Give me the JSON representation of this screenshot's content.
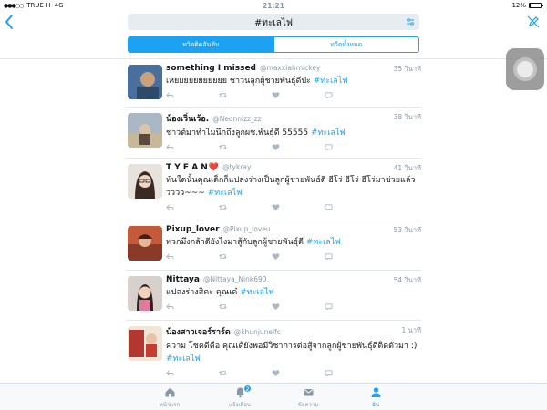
{
  "status_bar": {
    "carrier": "TRUE-H",
    "network": "4G",
    "time": "21:21",
    "battery_text": "12%",
    "battery_level": 0.12
  },
  "search": {
    "query": "#ทะเลไฟ",
    "back_icon": "chevron-left-icon",
    "filter_icon": "sliders-icon",
    "mute_icon": "pen-slash-icon"
  },
  "tabs": {
    "top": "ทวิตติดอันดับ",
    "all": "ทวีตทั้งหมด",
    "active": "top"
  },
  "tweets": [
    {
      "name": "something I missed",
      "handle": "@maxxiahmickey",
      "time": "35 วินาที",
      "text": "เหยยยยยยยยยยย ชาวนลูกผู้ชายพันธุ์ดีป่ะ",
      "hashtag": "#ทะเลไฟ",
      "avatar_colors": [
        "#4a6f9c",
        "#c9a27c"
      ]
    },
    {
      "name": "น้องเวิ่นเว้อ.",
      "handle": "@Neonnizz_zz",
      "time": "38 วินาที",
      "text": "ชาวต์มาทำไมนึกถึงลูกผช.พันธุ์ดี 55555",
      "hashtag": "#ทะเลไฟ",
      "avatar_colors": [
        "#a9b8c4",
        "#d9c3a9"
      ]
    },
    {
      "name": "T Y F A N",
      "name_suffix": "❤️",
      "handle": "@tykray",
      "time": "41 วินาที",
      "text": "ทันใดนั้นคุณเด็กก็แปลงร่างเป็นลูกผู้ชายพันธ์ดี ฮีโร่ ฮีโร่ ฮีโร่มาช่วยแล้ววววว~~~",
      "hashtag": "#ทะเลไฟ",
      "avatar_colors": [
        "#e8e2dc",
        "#3b2a22"
      ]
    },
    {
      "name": "Pixup_lover",
      "handle": "@Pixup_loveu",
      "time": "53 วินาที",
      "text": "พวกมึงกล้าดียังไงมาสู้กับลูกผู้ชายพันธุ์ดี",
      "hashtag": "#ทะเลไฟ",
      "avatar_colors": [
        "#c45a3a",
        "#e8b49a"
      ]
    },
    {
      "name": "Nittaya",
      "handle": "@Nittaya_Nink690",
      "time": "54 วินาที",
      "text": "แปลงร่างสิคะ คุณเด๋",
      "hashtag": "#ทะเลไฟ",
      "avatar_colors": [
        "#d8d0cc",
        "#2b2320"
      ]
    },
    {
      "name": "น้องสาวเจอร์ราร์ด",
      "handle": "@khunjunelfc",
      "time": "1 นาที",
      "text": "ความ โชคดีคือ คุณเด้ยังพอมีวิชาการต่อสู้จากลูกผู้ชายพันธุ์ดีติดตัวมา :)",
      "hashtag": "#ทะเลไฟ",
      "avatar_colors": [
        "#b3372e",
        "#f0e6d8"
      ]
    }
  ],
  "tabbar": {
    "items": [
      {
        "label": "หน้าแรก",
        "icon": "home-icon"
      },
      {
        "label": "แจ้งเตือน",
        "icon": "bell-icon",
        "badge": "2"
      },
      {
        "label": "ข้อความ",
        "icon": "mail-icon"
      },
      {
        "label": "ฉัน",
        "icon": "person-icon",
        "active": true
      }
    ]
  },
  "colors": {
    "accent": "#1da1f2",
    "muted": "#8899a6",
    "divider": "#e1e8ed"
  }
}
